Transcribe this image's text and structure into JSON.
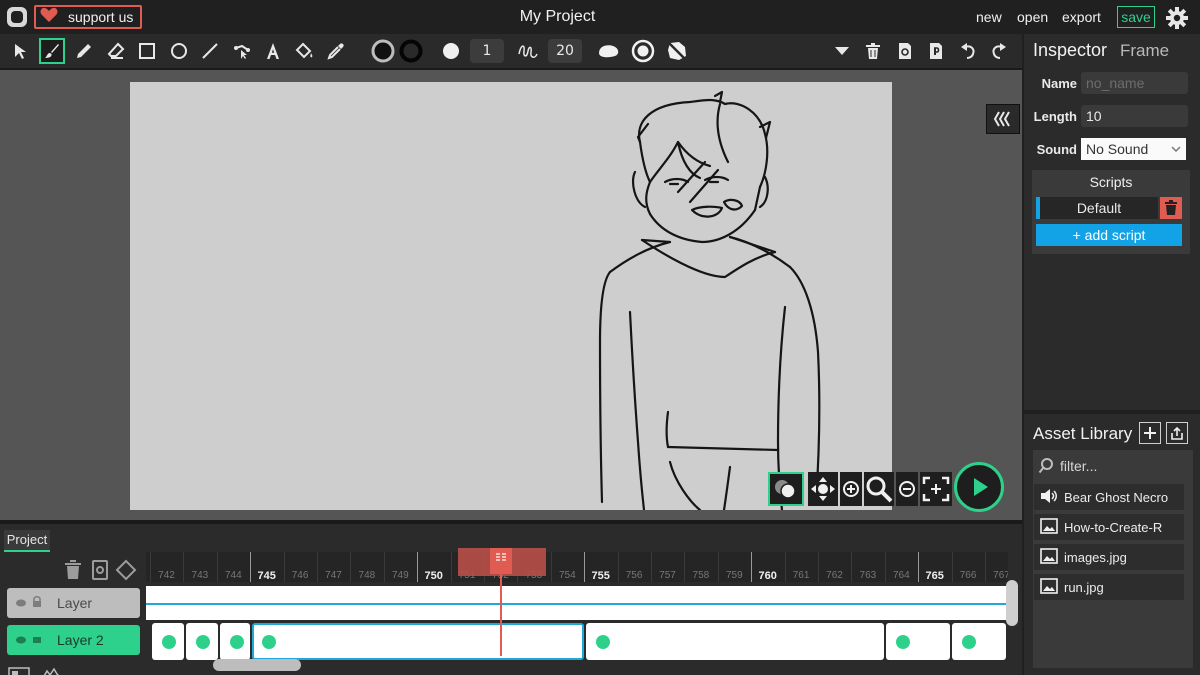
{
  "menubar": {
    "support_label": "support us",
    "project_title": "My Project",
    "new_label": "new",
    "open_label": "open",
    "export_label": "export",
    "save_label": "save"
  },
  "toolbar": {
    "stroke_width": "1",
    "smoothing": "20"
  },
  "timeline": {
    "tab_label": "Project",
    "ticks": [
      "742",
      "743",
      "744",
      "745",
      "746",
      "747",
      "748",
      "749",
      "750",
      "751",
      "752",
      "753",
      "754",
      "755",
      "756",
      "757",
      "758",
      "759",
      "760",
      "761",
      "762",
      "763",
      "764",
      "765",
      "766",
      "767"
    ],
    "layers": [
      {
        "name": "Layer"
      },
      {
        "name": "Layer 2"
      }
    ]
  },
  "inspector": {
    "title": "Inspector",
    "subtitle": "Frame",
    "name_label": "Name",
    "name_placeholder": "no_name",
    "length_label": "Length",
    "length_value": "10",
    "sound_label": "Sound",
    "sound_value": "No Sound",
    "scripts_label": "Scripts",
    "script_default": "Default",
    "add_script_label": "+ add script"
  },
  "asset_library": {
    "title": "Asset Library",
    "filter_placeholder": "filter...",
    "items": [
      {
        "name": "Bear Ghost Necro",
        "type": "sound"
      },
      {
        "name": "How-to-Create-R",
        "type": "image"
      },
      {
        "name": "images.jpg",
        "type": "image"
      },
      {
        "name": "run.jpg",
        "type": "image"
      }
    ]
  },
  "colors": {
    "accent": "#2ed18b",
    "danger": "#e05c52",
    "selection": "#1ea9d8",
    "add_script": "#12a3e6"
  }
}
